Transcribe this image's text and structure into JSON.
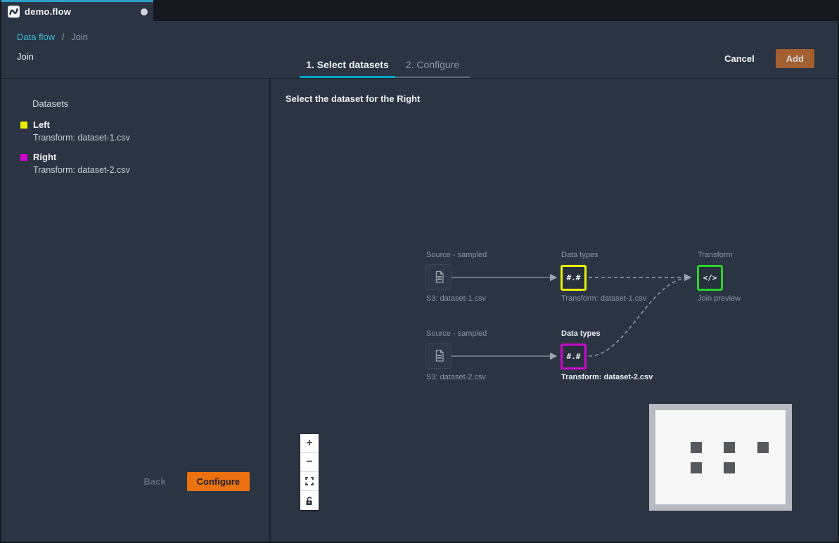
{
  "window": {
    "tab": {
      "title": "demo.flow",
      "icon": "data-wrangler-wave-icon",
      "modified_indicator": "unsaved-dot"
    }
  },
  "header": {
    "breadcrumb": {
      "link": "Data flow",
      "separator": "/",
      "current": "Join"
    },
    "title": "Join",
    "steps": [
      {
        "label": "1. Select datasets",
        "active": true
      },
      {
        "label": "2. Configure",
        "active": false
      }
    ],
    "actions": {
      "cancel": "Cancel",
      "add": "Add"
    }
  },
  "sidebar": {
    "heading": "Datasets",
    "datasets": [
      {
        "name": "Left",
        "detail": "Transform: dataset-1.csv",
        "swatch_color": "#e9ef04"
      },
      {
        "name": "Right",
        "detail": "Transform: dataset-2.csv",
        "swatch_color": "#cf06cf"
      }
    ],
    "footer": {
      "back": "Back",
      "configure": "Configure"
    }
  },
  "canvas": {
    "heading": "Select the dataset for the Right",
    "nodes": {
      "source1": {
        "top_label": "Source - sampled",
        "bottom_label": "S3: dataset-1.csv",
        "icon": "document-icon"
      },
      "datatypes1": {
        "top_label": "Data types",
        "glyph": "#.#",
        "bottom_label": "Transform: dataset-1.csv",
        "border_color": "#e9ef04"
      },
      "transform": {
        "top_label": "Transform",
        "glyph": "</>",
        "bottom_label": "Join preview",
        "border_color": "#2bd12b"
      },
      "source2": {
        "top_label": "Source - sampled",
        "bottom_label": "S3: dataset-2.csv",
        "icon": "document-icon"
      },
      "datatypes2": {
        "top_label": "Data types",
        "glyph": "#.#",
        "bottom_label": "Transform: dataset-2.csv",
        "border_color": "#cf06cf",
        "highlighted": true
      }
    },
    "zoom_controls": {
      "zoom_in": "+",
      "zoom_out": "−",
      "fit": "fit-view",
      "lock": "unlock-open"
    }
  },
  "colors": {
    "accent_cyan": "#00a1c9",
    "link_cyan": "#3fb8d4",
    "primary_orange": "#ec7211",
    "disabled_orange": "#a35f2f",
    "node_yellow": "#e9ef04",
    "node_magenta": "#cf06cf",
    "node_green": "#2bd12b",
    "background": "#2a3442",
    "frame": "#15191f"
  }
}
